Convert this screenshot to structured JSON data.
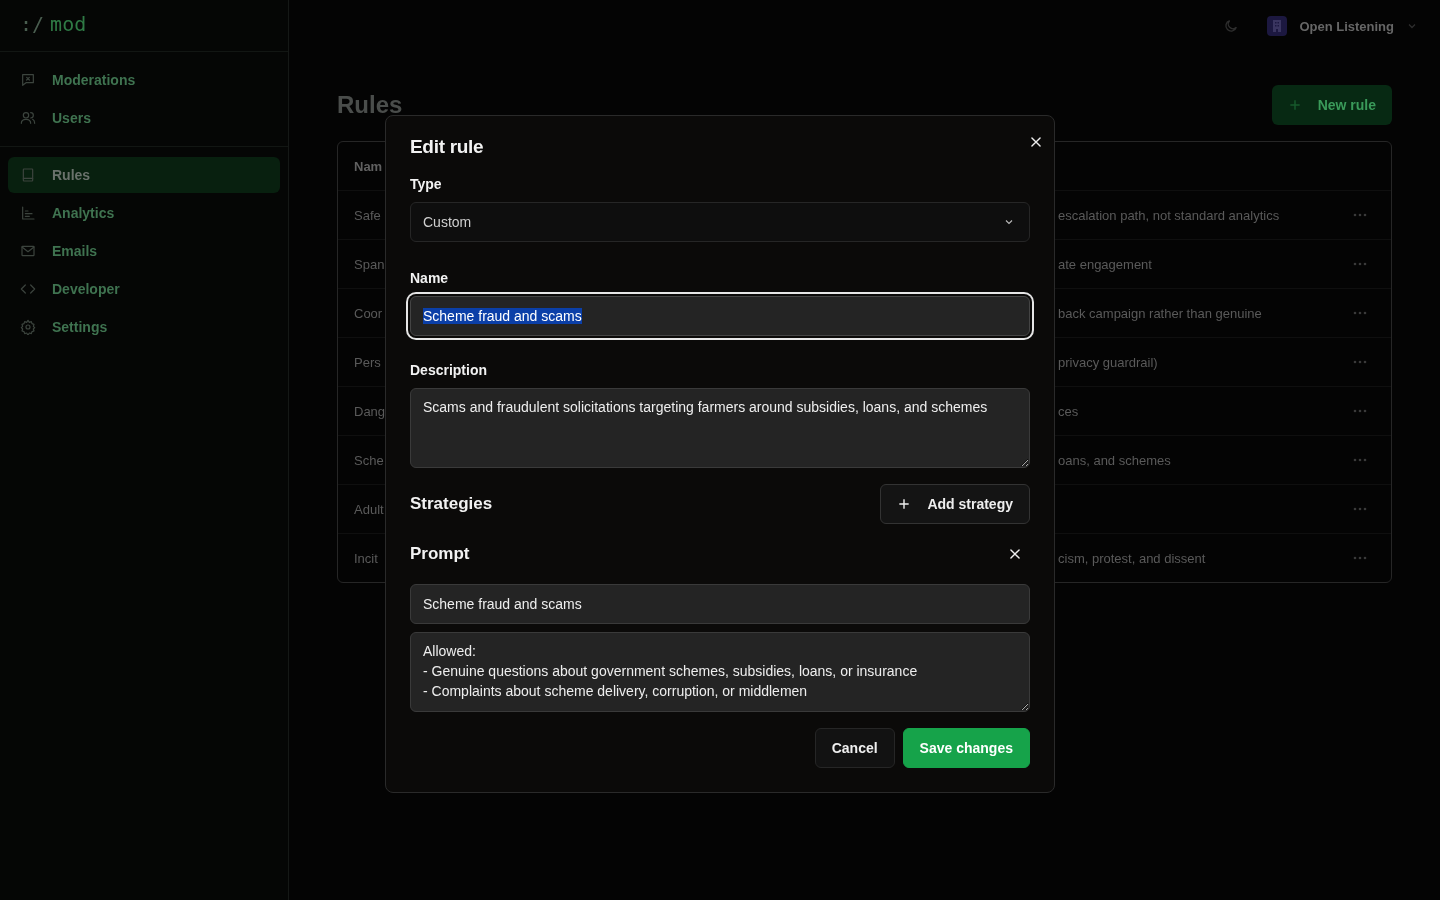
{
  "sidebar": {
    "logo": {
      "prefix": ":/",
      "name": "mod"
    },
    "groups": [
      [
        {
          "label": "Moderations",
          "kind": "message",
          "selected": false
        },
        {
          "label": "Users",
          "kind": "users",
          "selected": false
        }
      ],
      [
        {
          "label": "Rules",
          "kind": "book",
          "selected": true
        },
        {
          "label": "Analytics",
          "kind": "chart",
          "selected": false
        },
        {
          "label": "Emails",
          "kind": "mail",
          "selected": false
        },
        {
          "label": "Developer",
          "kind": "code",
          "selected": false
        },
        {
          "label": "Settings",
          "kind": "gear",
          "selected": false
        }
      ]
    ]
  },
  "topbar": {
    "organization": "Open Listening"
  },
  "page": {
    "title": "Rules",
    "new_button": "New rule",
    "table": {
      "columns": [
        "Nam"
      ],
      "rows": [
        {
          "name": "Safe",
          "description": "escalation path, not standard analytics"
        },
        {
          "name": "Span",
          "description": "ate engagement"
        },
        {
          "name": "Coor",
          "description": "back campaign rather than genuine"
        },
        {
          "name": "Pers",
          "description": "privacy guardrail)"
        },
        {
          "name": "Dang",
          "description": "ces"
        },
        {
          "name": "Sche",
          "description": "oans, and schemes"
        },
        {
          "name": "Adult"
        },
        {
          "name": "Incit",
          "description": "cism, protest, and dissent"
        }
      ]
    }
  },
  "dialog": {
    "title": "Edit rule",
    "type": {
      "label": "Type",
      "value": "Custom"
    },
    "name": {
      "label": "Name",
      "value": "Scheme fraud and scams",
      "text_selected": true
    },
    "description": {
      "label": "Description",
      "value": "Scams and fraudulent solicitations targeting farmers around subsidies, loans, and schemes"
    },
    "strategies": {
      "heading": "Strategies",
      "add_button": "Add strategy"
    },
    "prompt": {
      "heading": "Prompt",
      "name": "Scheme fraud and scams",
      "text": "Allowed:\n- Genuine questions about government schemes, subsidies, loans, or insurance\n- Complaints about scheme delivery, corruption, or middlemen"
    },
    "buttons": {
      "cancel": "Cancel",
      "save": "Save changes"
    }
  }
}
